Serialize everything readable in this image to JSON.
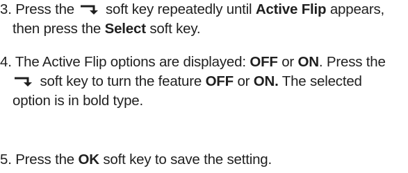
{
  "steps": [
    {
      "number": "3.",
      "line1_a": "Press the",
      "line1_b": "soft key repeatedly until",
      "line1_bold": "Active Flip",
      "line1_c": "appears,",
      "line2_a": "then press the",
      "line2_bold": "Select",
      "line2_b": "soft key."
    },
    {
      "number": "4.",
      "line1_a": "The Active Flip options are displayed:",
      "line1_bold1": "OFF",
      "line1_or": "or",
      "line1_bold2": "ON",
      "line1_b": ". Press the",
      "line2_a": "soft key to turn the feature",
      "line2_bold1": "OFF",
      "line2_or": "or",
      "line2_bold2": "ON.",
      "line2_b": "The selected",
      "line3": "option is in bold type."
    },
    {
      "number": "5.",
      "line1_a": "Press the",
      "line1_bold": "OK",
      "line1_b": "soft key to save the setting."
    }
  ],
  "icons": {
    "soft_key_icon": "down-right-arrow-icon"
  },
  "colors": {
    "text": "#1f1f1f",
    "icon": "#1f1f1f"
  }
}
